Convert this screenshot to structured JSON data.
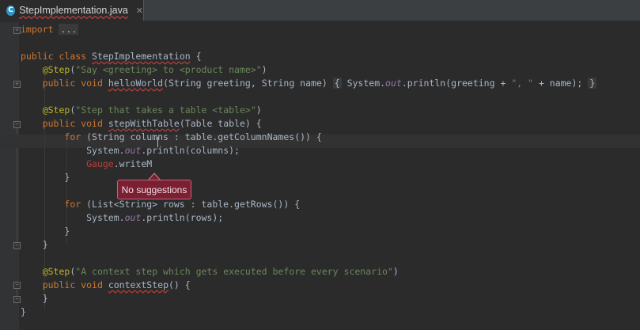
{
  "tab": {
    "icon_letter": "C",
    "title": "StepImplementation.java",
    "close": "✕"
  },
  "code": {
    "l1_kw": "import",
    "l1_fold": "...",
    "l2_kw1": "public",
    "l2_kw2": "class",
    "l2_name": "StepImplementation",
    "l2_rest": " {",
    "l3_ann": "@Step",
    "l3_str": "\"Say <greeting> to <product name>\"",
    "l4_kw1": "public",
    "l4_kw2": "void",
    "l4_name": "helloWorld",
    "l4_params": "(String greeting, String name) ",
    "l4_lb": "{",
    "l4_sys": " System.",
    "l4_out": "out",
    "l4_call": ".println(greeting + ",
    "l4_str": "\", \"",
    "l4_tail": " + name);",
    "l4_rb": "}",
    "l5_ann": "@Step",
    "l5_str": "\"Step that takes a table <table>\"",
    "l6_kw1": "public",
    "l6_kw2": "void",
    "l6_name": "stepWithTable",
    "l6_rest": "(Table table) {",
    "l7_kw": "for",
    "l7_rest": " (String columns : table.getColumnNames()) {",
    "l8_sys": "System.",
    "l8_out": "out",
    "l8_rest": ".println(columns);",
    "l9_gauge": "Gauge",
    "l9_rest": ".writeM",
    "l10": "}",
    "l11_kw": "for",
    "l11_rest": " (List<String> rows : table.getRows()) {",
    "l12_sys": "System.",
    "l12_out": "out",
    "l12_rest": ".println(rows);",
    "l13": "}",
    "l14": "}",
    "l15_ann": "@Step",
    "l15_str": "\"A context step which gets executed before every scenario\"",
    "l16_kw1": "public",
    "l16_kw2": "void",
    "l16_name": "contextStep",
    "l16_rest": "() {",
    "l17": "}",
    "l18": "}"
  },
  "tooltip": {
    "text": "No suggestions"
  },
  "colors": {
    "background": "#2b2b2b",
    "keyword": "#cc7832",
    "annotation": "#bbb529",
    "string": "#6a8759",
    "error": "#bc3f3c",
    "tooltip": "#7b1f33"
  }
}
